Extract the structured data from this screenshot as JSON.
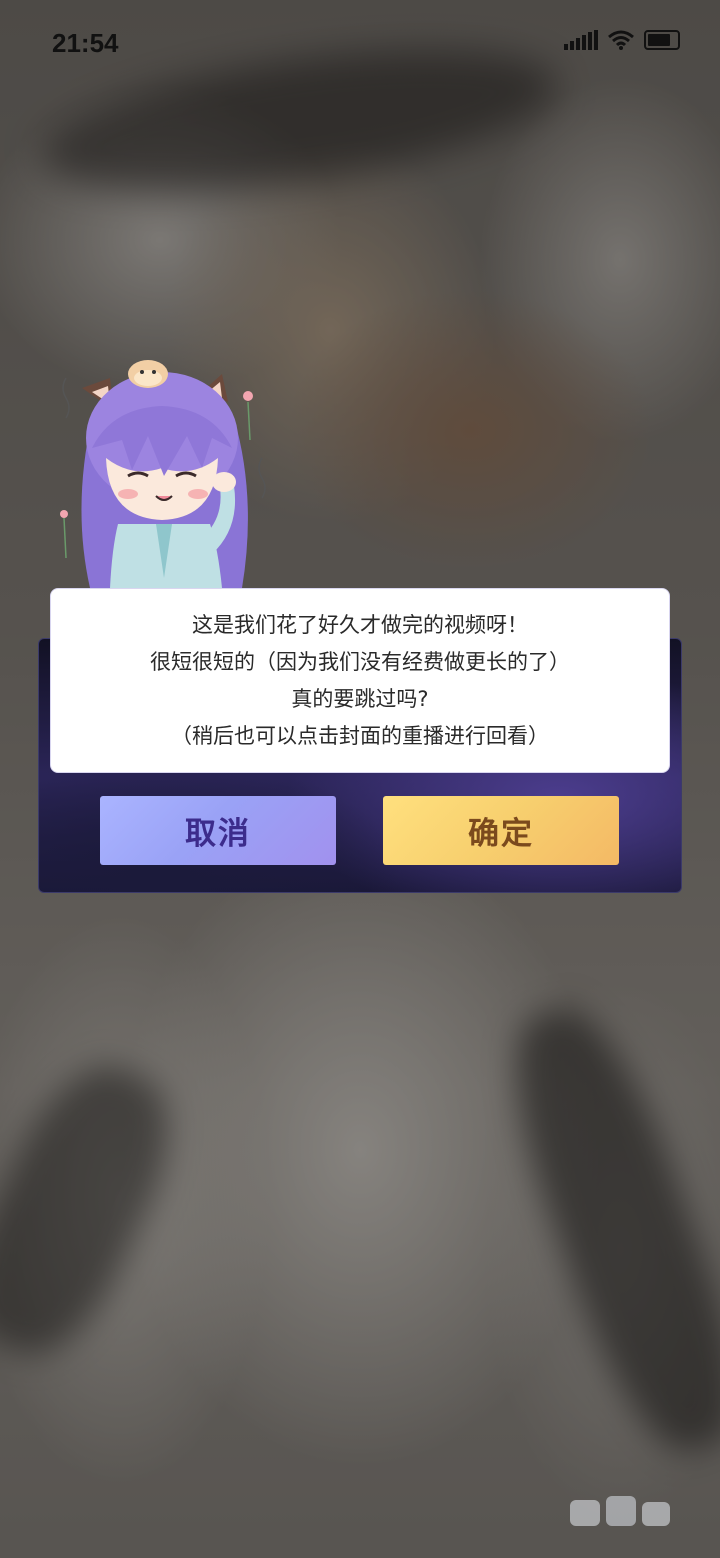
{
  "status_bar": {
    "time": "21:54",
    "icons": [
      "signal-icon",
      "wifi-icon",
      "battery-icon"
    ]
  },
  "dialog": {
    "lines": [
      "这是我们花了好久才做完的视频呀！",
      "很短很短的（因为我们没有经费做更长的了）",
      "真的要跳过吗?",
      "（稍后也可以点击封面的重播进行回看）"
    ],
    "cancel_label": "取消",
    "confirm_label": "确定"
  },
  "colors": {
    "cancel_button": "#9aa2f6",
    "confirm_button": "#f7cf6e",
    "panel": "#2b2558"
  }
}
